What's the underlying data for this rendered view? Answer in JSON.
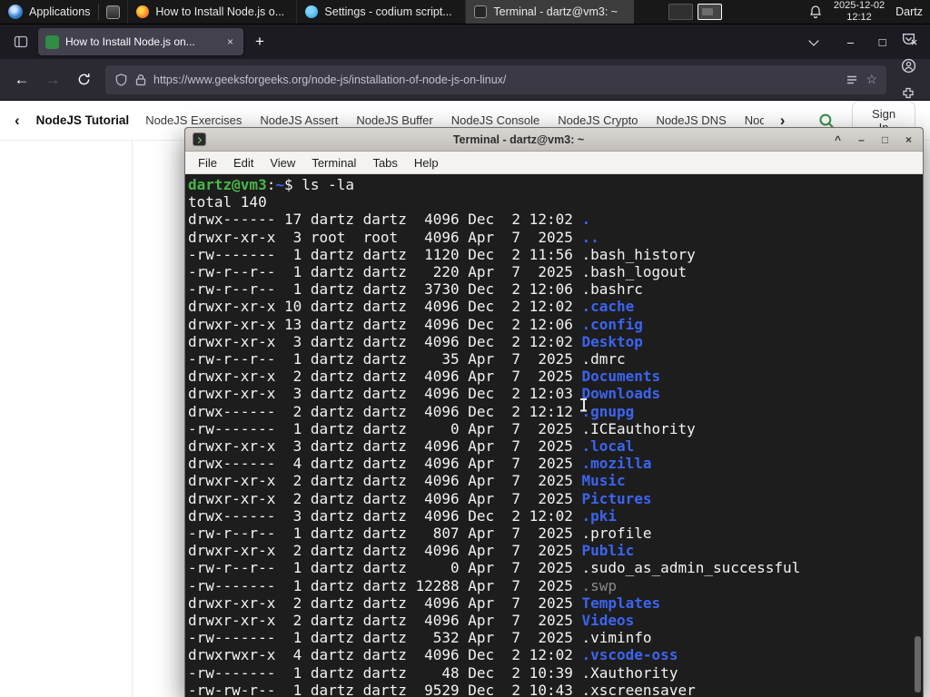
{
  "icons": {
    "new_tab": "+",
    "tab_close": "×",
    "close": "×",
    "minimize": "–",
    "maximize": "□",
    "shade": "^",
    "back": "←",
    "forward": "→",
    "star": "☆",
    "nav_prev": "‹",
    "nav_next": "›"
  },
  "colors": {
    "accent_green": "#2f8d46",
    "term_green": "#47b747",
    "term_blue": "#3c64f0",
    "term_fg": "#f2f2f2",
    "term_dim": "#8a8a8a"
  },
  "panel": {
    "applications": "Applications",
    "taskbar": [
      {
        "icon": "firefox",
        "label": "How to Install Node.js o...",
        "active": false
      },
      {
        "icon": "codium",
        "label": "Settings - codium script...",
        "active": false
      },
      {
        "icon": "terminal",
        "label": "Terminal - dartz@vm3: ~",
        "active": true
      }
    ],
    "clock_date": "2025-12-02",
    "clock_time": "12:12",
    "user": "Dartz"
  },
  "browser": {
    "active_tab_title": "How to Install Node.js on...",
    "url": "https://www.geeksforgeeks.org/node-js/installation-of-node-js-on-linux/"
  },
  "site_nav": {
    "primary": "NodeJS Tutorial",
    "links": [
      "NodeJS Exercises",
      "NodeJS Assert",
      "NodeJS Buffer",
      "NodeJS Console",
      "NodeJS Crypto",
      "NodeJS DNS",
      "Node"
    ],
    "sign_in": "Sign In"
  },
  "terminal": {
    "title": "Terminal - dartz@vm3: ~",
    "menu": [
      "File",
      "Edit",
      "View",
      "Terminal",
      "Tabs",
      "Help"
    ],
    "prompt_user_host": "dartz@vm3",
    "prompt_sep": ":",
    "prompt_path": "~",
    "prompt_symbol": "$",
    "command": "ls -la",
    "total": "total 140",
    "rows": [
      {
        "meta": "drwx------ 17 dartz dartz  4096 Dec  2 12:02 ",
        "name": ".",
        "type": "dir"
      },
      {
        "meta": "drwxr-xr-x  3 root  root   4096 Apr  7  2025 ",
        "name": "..",
        "type": "dir"
      },
      {
        "meta": "-rw-------  1 dartz dartz  1120 Dec  2 11:56 ",
        "name": ".bash_history",
        "type": "file"
      },
      {
        "meta": "-rw-r--r--  1 dartz dartz   220 Apr  7  2025 ",
        "name": ".bash_logout",
        "type": "file"
      },
      {
        "meta": "-rw-r--r--  1 dartz dartz  3730 Dec  2 12:06 ",
        "name": ".bashrc",
        "type": "file"
      },
      {
        "meta": "drwxr-xr-x 10 dartz dartz  4096 Dec  2 12:02 ",
        "name": ".cache",
        "type": "dir"
      },
      {
        "meta": "drwxr-xr-x 13 dartz dartz  4096 Dec  2 12:06 ",
        "name": ".config",
        "type": "dir"
      },
      {
        "meta": "drwxr-xr-x  3 dartz dartz  4096 Dec  2 12:02 ",
        "name": "Desktop",
        "type": "dir"
      },
      {
        "meta": "-rw-r--r--  1 dartz dartz    35 Apr  7  2025 ",
        "name": ".dmrc",
        "type": "file"
      },
      {
        "meta": "drwxr-xr-x  2 dartz dartz  4096 Apr  7  2025 ",
        "name": "Documents",
        "type": "dir"
      },
      {
        "meta": "drwxr-xr-x  3 dartz dartz  4096 Dec  2 12:03 ",
        "name": "Downloads",
        "type": "dir"
      },
      {
        "meta": "drwx------  2 dartz dartz  4096 Dec  2 12:12 ",
        "name": ".gnupg",
        "type": "dir"
      },
      {
        "meta": "-rw-------  1 dartz dartz     0 Apr  7  2025 ",
        "name": ".ICEauthority",
        "type": "file"
      },
      {
        "meta": "drwxr-xr-x  3 dartz dartz  4096 Apr  7  2025 ",
        "name": ".local",
        "type": "dir"
      },
      {
        "meta": "drwx------  4 dartz dartz  4096 Apr  7  2025 ",
        "name": ".mozilla",
        "type": "dir"
      },
      {
        "meta": "drwxr-xr-x  2 dartz dartz  4096 Apr  7  2025 ",
        "name": "Music",
        "type": "dir"
      },
      {
        "meta": "drwxr-xr-x  2 dartz dartz  4096 Apr  7  2025 ",
        "name": "Pictures",
        "type": "dir"
      },
      {
        "meta": "drwx------  3 dartz dartz  4096 Dec  2 12:02 ",
        "name": ".pki",
        "type": "dir"
      },
      {
        "meta": "-rw-r--r--  1 dartz dartz   807 Apr  7  2025 ",
        "name": ".profile",
        "type": "file"
      },
      {
        "meta": "drwxr-xr-x  2 dartz dartz  4096 Apr  7  2025 ",
        "name": "Public",
        "type": "dir"
      },
      {
        "meta": "-rw-r--r--  1 dartz dartz     0 Apr  7  2025 ",
        "name": ".sudo_as_admin_successful",
        "type": "file"
      },
      {
        "meta": "-rw-------  1 dartz dartz 12288 Apr  7  2025 ",
        "name": ".swp",
        "type": "dim"
      },
      {
        "meta": "drwxr-xr-x  2 dartz dartz  4096 Apr  7  2025 ",
        "name": "Templates",
        "type": "dir"
      },
      {
        "meta": "drwxr-xr-x  2 dartz dartz  4096 Apr  7  2025 ",
        "name": "Videos",
        "type": "dir"
      },
      {
        "meta": "-rw-------  1 dartz dartz   532 Apr  7  2025 ",
        "name": ".viminfo",
        "type": "file"
      },
      {
        "meta": "drwxrwxr-x  4 dartz dartz  4096 Dec  2 12:02 ",
        "name": ".vscode-oss",
        "type": "dir"
      },
      {
        "meta": "-rw-------  1 dartz dartz    48 Dec  2 10:39 ",
        "name": ".Xauthority",
        "type": "file"
      },
      {
        "meta": "-rw-rw-r--  1 dartz dartz  9529 Dec  2 10:43 ",
        "name": ".xscreensaver",
        "type": "file"
      }
    ]
  }
}
